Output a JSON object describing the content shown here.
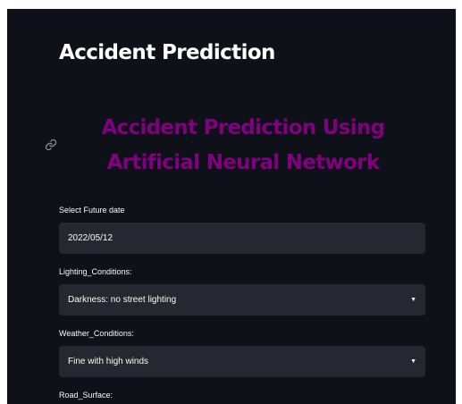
{
  "page_title": "Accident Prediction",
  "main_heading": "Accident Prediction Using Artificial Neural Network",
  "heading_color": "#800080",
  "icons": {
    "anchor_link": "link-icon",
    "select_arrow": "chevron-down-icon"
  },
  "form": {
    "date": {
      "label": "Select Future date",
      "value": "2022/05/12"
    },
    "lighting": {
      "label": "Lighting_Conditions:",
      "value": "Darkness: no street lighting"
    },
    "weather": {
      "label": "Weather_Conditions:",
      "value": "Fine with high winds"
    },
    "road_surface": {
      "label": "Road_Surface:"
    }
  }
}
